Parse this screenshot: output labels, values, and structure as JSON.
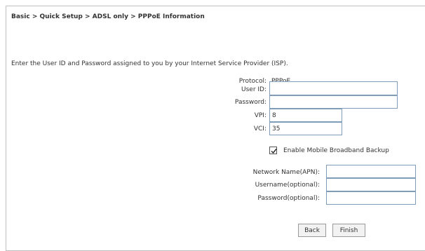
{
  "breadcrumb": "Basic > Quick Setup > ADSL only > PPPoE Information",
  "intro_text": "Enter the User ID and Password assigned to you by your Internet Service Provider (ISP).",
  "form": {
    "protocol_label": "Protocol:",
    "protocol_value": "PPPoE",
    "user_id_label": "User ID:",
    "user_id_value": "",
    "password_label": "Password:",
    "password_value": "",
    "vpi_label": "VPI:",
    "vpi_value": "8",
    "vci_label": "VCI:",
    "vci_value": "35"
  },
  "backup": {
    "checkbox_checked": true,
    "checkbox_label": "Enable Mobile Broadband Backup",
    "apn_label": "Network Name(APN):",
    "apn_value": "",
    "username_label": "Username(optional):",
    "username_value": "",
    "password_label": "Password(optional):",
    "password_value": ""
  },
  "buttons": {
    "back_label": "Back",
    "finish_label": "Finish"
  }
}
